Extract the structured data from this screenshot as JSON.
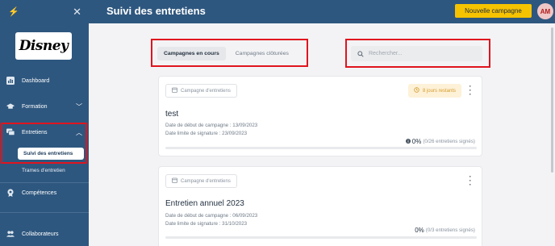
{
  "sidebar": {
    "logo_text": "Disney",
    "items": [
      {
        "label": "Dashboard",
        "icon": "chart-icon"
      },
      {
        "label": "Formation",
        "icon": "graduation-cap-icon"
      },
      {
        "label": "Entretiens",
        "icon": "chat-icon"
      },
      {
        "label": "Compétences",
        "icon": "badge-icon"
      },
      {
        "label": "Collaborateurs",
        "icon": "users-icon"
      }
    ],
    "sub_items": {
      "active": "Suivi des entretiens",
      "other": "Trames d'entretien"
    }
  },
  "header": {
    "title": "Suivi des entretiens",
    "new_campaign_label": "Nouvelle campagne",
    "avatar_initials": "AM"
  },
  "tabs": [
    {
      "label": "Campagnes en cours",
      "active": true
    },
    {
      "label": "Campagnes clôturées",
      "active": false
    }
  ],
  "search": {
    "placeholder": "Rechercher..."
  },
  "cards": [
    {
      "badge": "Campagne d'entretiens",
      "days_left": "8 jours restants",
      "title": "test",
      "start_date": "Date de début de campagne : 13/09/2023",
      "end_date": "Date limite de signature : 23/09/2023",
      "percent": "0%",
      "signed": "(0/26 entretiens signés)",
      "progress": 0
    },
    {
      "badge": "Campagne d'entretiens",
      "title": "Entretien annuel 2023",
      "start_date": "Date de début de campagne : 06/09/2023",
      "end_date": "Date limite de signature : 31/10/2023",
      "percent": "0%",
      "signed": "(0/3 entretiens signés)",
      "progress": 0
    }
  ],
  "colors": {
    "primary": "#2e577f",
    "accent": "#f6c300",
    "highlight": "#e0141e"
  }
}
